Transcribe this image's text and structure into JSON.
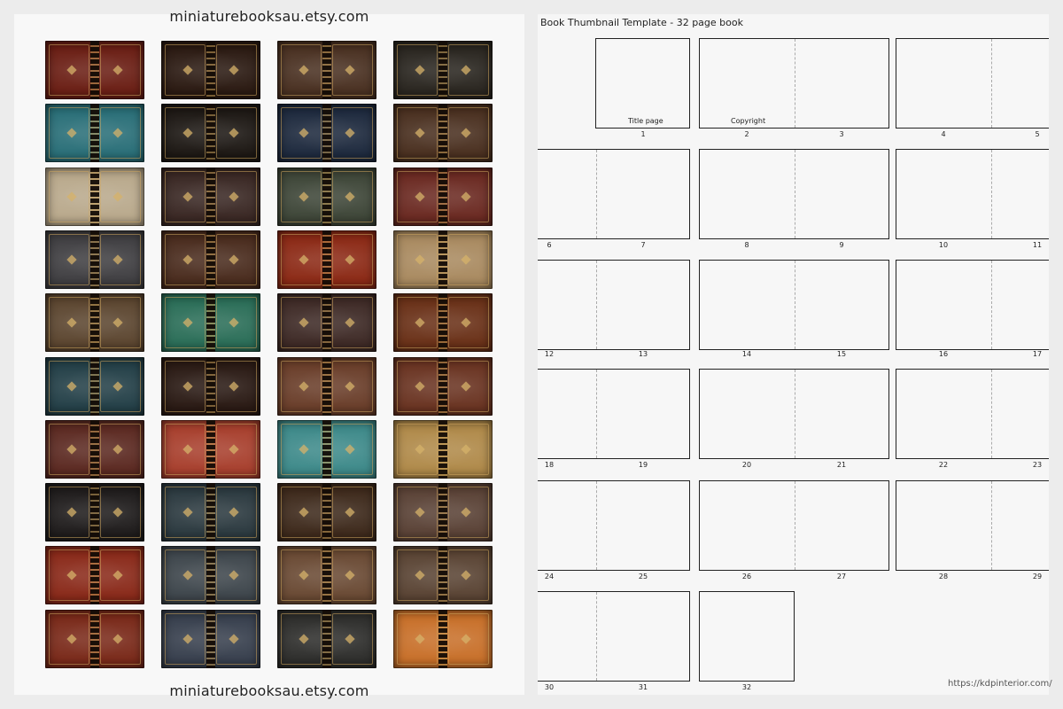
{
  "shop": {
    "top_text": "miniaturebooksau.etsy.com",
    "bottom_text": "miniaturebooksau.etsy.com"
  },
  "covers": {
    "columns": 4,
    "rows": 10,
    "colors": [
      "#6b1f15",
      "#2b1a12",
      "#4a3122",
      "#2a2620",
      "#2a6f78",
      "#1d1814",
      "#1e2a3e",
      "#4a3020",
      "#b9a98c",
      "#3a2824",
      "#3e4638",
      "#6b2a22",
      "#403f42",
      "#4a2c1e",
      "#8c2a16",
      "#a98a60",
      "#5c4630",
      "#2b6e58",
      "#3e2a26",
      "#6a3118",
      "#244048",
      "#2a1a14",
      "#6a3e2a",
      "#6a3422",
      "#5c2a22",
      "#a8402e",
      "#3e8a8a",
      "#b08a4a",
      "#1f1c1c",
      "#2c3a40",
      "#3e2a1c",
      "#5a4236",
      "#8a2a1a",
      "#3e464c",
      "#6a4a34",
      "#5a4434",
      "#7a2a1a",
      "#38404e",
      "#2e2e2c",
      "#c8702a"
    ]
  },
  "template": {
    "title": "Book Thumbnail Template - 32 page book",
    "title_page_label": "Title page",
    "copyright_label": "Copyright",
    "numbers": [
      "1",
      "2",
      "3",
      "4",
      "5",
      "6",
      "7",
      "8",
      "9",
      "10",
      "11",
      "12",
      "13",
      "14",
      "15",
      "16",
      "17",
      "18",
      "19",
      "20",
      "21",
      "22",
      "23",
      "24",
      "25",
      "26",
      "27",
      "28",
      "29",
      "30",
      "31",
      "32"
    ]
  },
  "watermark": "https://kdpinterior.com/"
}
